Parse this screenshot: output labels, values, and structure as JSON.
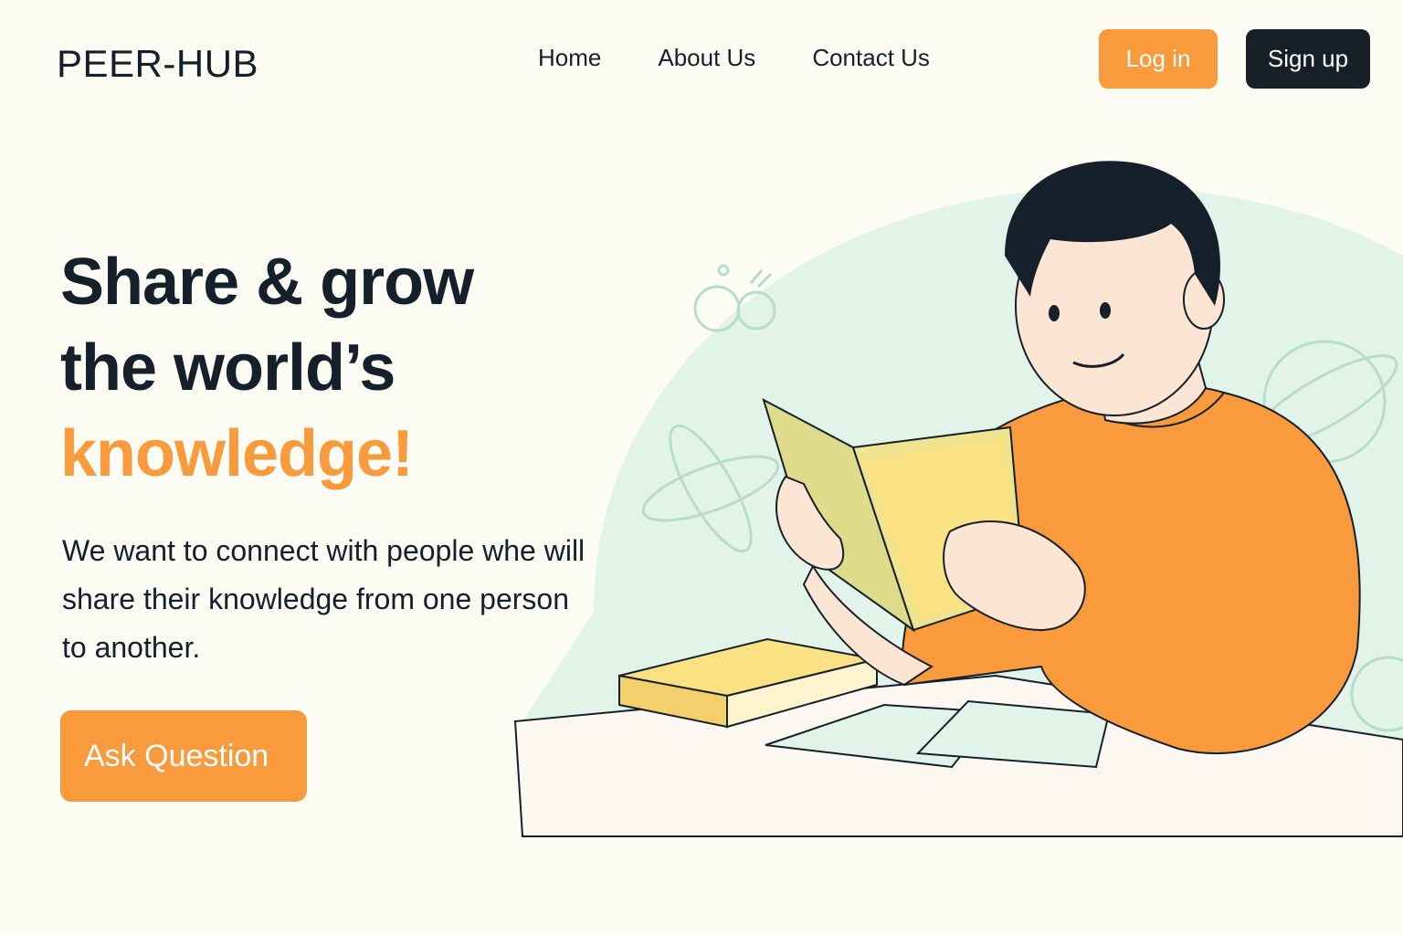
{
  "brand": {
    "logo": "PEER-HUB"
  },
  "nav": {
    "links": [
      "Home",
      "About Us",
      "Contact Us"
    ],
    "login_label": "Log in",
    "signup_label": "Sign up"
  },
  "hero": {
    "title_line1": "Share & grow",
    "title_line2": "the world’s",
    "title_accent": "knowledge!",
    "description": "We want to connect with people whe will share their knowledge from one person to another.",
    "cta_label": "Ask Question"
  },
  "illustration": {
    "subject": "person-reading-book-icon"
  },
  "colors": {
    "accent": "#f99a3c",
    "dark": "#172026",
    "background": "#fcfcf4",
    "mint": "#e2f4ea",
    "book_yellow": "#fae182",
    "book_green": "#dedb8a"
  }
}
